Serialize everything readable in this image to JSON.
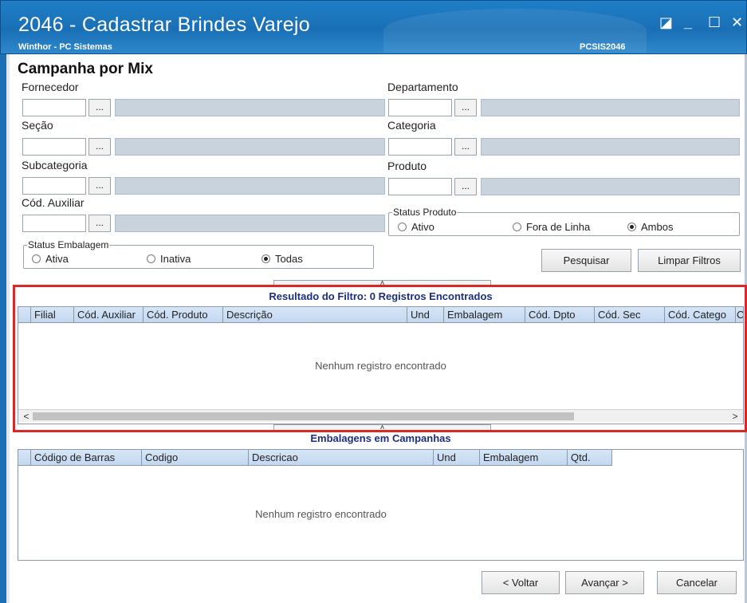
{
  "window": {
    "title": "2046 - Cadastrar Brindes Varejo",
    "subtitle": "Winthor - PC Sistemas",
    "code": "PCSIS2046",
    "controls": {
      "restore": "◪",
      "minimize": "_",
      "maximize": "☐",
      "close": "✕"
    }
  },
  "section_title": "Campanha por Mix",
  "filters": {
    "fornecedor": "Fornecedor",
    "secao": "Seção",
    "subcategoria": "Subcategoria",
    "cod_auxiliar": "Cód. Auxiliar",
    "departamento": "Departamento",
    "categoria": "Categoria",
    "produto": "Produto",
    "lookup_button": "..."
  },
  "status_produto": {
    "legend": "Status Produto",
    "options": [
      "Ativo",
      "Fora de Linha",
      "Ambos"
    ],
    "selected": "Ambos"
  },
  "status_embalagem": {
    "legend": "Status Embalagem",
    "options": [
      "Ativa",
      "Inativa",
      "Todas"
    ],
    "selected": "Todas"
  },
  "buttons": {
    "pesquisar": "Pesquisar",
    "limpar": "Limpar Filtros",
    "voltar": "< Voltar",
    "avancar": "Avançar >",
    "cancelar": "Cancelar"
  },
  "result_grid": {
    "title": "Resultado do Filtro: 0 Registros Encontrados",
    "columns": [
      "Filial",
      "Cód. Auxiliar",
      "Cód. Produto",
      "Descrição",
      "Und",
      "Embalagem",
      "Cód. Dpto",
      "Cód. Sec",
      "Cód. Catego",
      "C"
    ],
    "empty_text": "Nenhum registro encontrado"
  },
  "package_grid": {
    "title": "Embalagens em Campanhas",
    "columns": [
      "Código de Barras",
      "Codigo",
      "Descricao",
      "Und",
      "Embalagem",
      "Qtd."
    ],
    "empty_text": "Nenhum registro encontrado"
  },
  "colors": {
    "titlebar": "#1a6fb5",
    "highlight": "#d42a2a",
    "grid_title": "#1c2f7d",
    "readonly_field": "#c9d3de"
  }
}
